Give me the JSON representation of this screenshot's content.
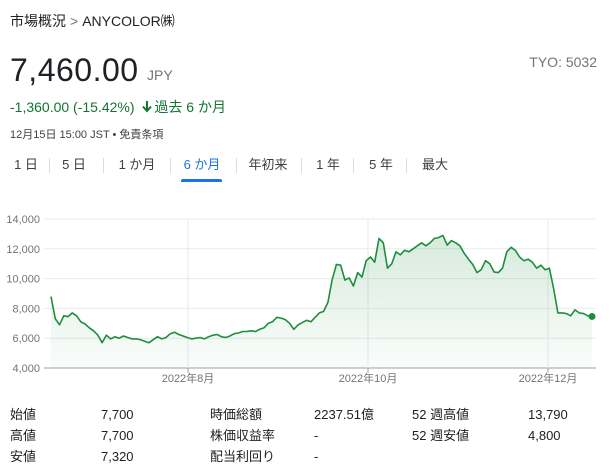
{
  "breadcrumb": {
    "parent": "市場概況",
    "separator": ">",
    "current": "ANYCOLOR㈱"
  },
  "quote": {
    "price": "7,460.00",
    "currency": "JPY",
    "ticker": "TYO: 5032",
    "change": "-1,360.00 (-15.42%)",
    "period_label": "過去 6 か月",
    "timestamp": "12月15日 15:00 JST • 免責条項",
    "change_color": "#137333"
  },
  "tabs": [
    {
      "label": "1 日",
      "active": false
    },
    {
      "label": "5 日",
      "active": false
    },
    {
      "label": "1 か月",
      "active": false
    },
    {
      "label": "6 か月",
      "active": true
    },
    {
      "label": "年初来",
      "active": false
    },
    {
      "label": "1 年",
      "active": false
    },
    {
      "label": "5 年",
      "active": false
    },
    {
      "label": "最大",
      "active": false
    }
  ],
  "chart_data": {
    "type": "area",
    "title": "",
    "xlabel": "",
    "ylabel": "",
    "ylim": [
      4000,
      14000
    ],
    "yticks": [
      "4,000",
      "6,000",
      "8,000",
      "10,000",
      "12,000",
      "14,000"
    ],
    "xticks": [
      "2022年8月",
      "2022年10月",
      "2022年12月"
    ],
    "grid": true,
    "color": "#1e8e3e",
    "series": [
      {
        "values": [
          8800,
          7300,
          6900,
          7500,
          7450,
          7700,
          7500,
          7100,
          6950,
          6700,
          6500,
          6200,
          5700,
          6200,
          5950,
          6100,
          6000,
          6150,
          6050,
          5950,
          5950,
          5900,
          5800,
          5700,
          5900,
          6100,
          5950,
          6050,
          6300,
          6400,
          6250,
          6150,
          6050,
          5950,
          6000,
          6050,
          5950,
          6100,
          6200,
          6250,
          6100,
          6050,
          6150,
          6300,
          6350,
          6450,
          6450,
          6500,
          6450,
          6600,
          6700,
          7000,
          7100,
          7400,
          7350,
          7250,
          7000,
          6600,
          6900,
          7050,
          7200,
          7100,
          7400,
          7700,
          7800,
          8400,
          9900,
          10950,
          10900,
          9900,
          10050,
          9500,
          10400,
          10100,
          11200,
          11450,
          11100,
          12700,
          12400,
          10700,
          11000,
          11800,
          11600,
          11900,
          11800,
          12000,
          12200,
          12400,
          12200,
          12400,
          12700,
          12750,
          12900,
          12250,
          12550,
          12400,
          12200,
          11700,
          11300,
          10950,
          10400,
          10600,
          11200,
          11000,
          10450,
          10400,
          10700,
          11800,
          12100,
          11900,
          11450,
          11200,
          11300,
          11100,
          10700,
          10900,
          10600,
          10700,
          9300,
          7700,
          7700,
          7650,
          7500,
          7900,
          7700,
          7650,
          7500,
          7460
        ]
      }
    ],
    "last_value": 7460
  },
  "stats": {
    "col1": [
      {
        "label": "始値",
        "value": "7,700"
      },
      {
        "label": "高値",
        "value": "7,700"
      },
      {
        "label": "安値",
        "value": "7,320"
      }
    ],
    "col2": [
      {
        "label": "時価総額",
        "value": "2237.51億"
      },
      {
        "label": "株価収益率",
        "value": "-"
      },
      {
        "label": "配当利回り",
        "value": "-"
      }
    ],
    "col3": [
      {
        "label": "52 週高値",
        "value": "13,790"
      },
      {
        "label": "52 週安値",
        "value": "4,800"
      }
    ]
  }
}
